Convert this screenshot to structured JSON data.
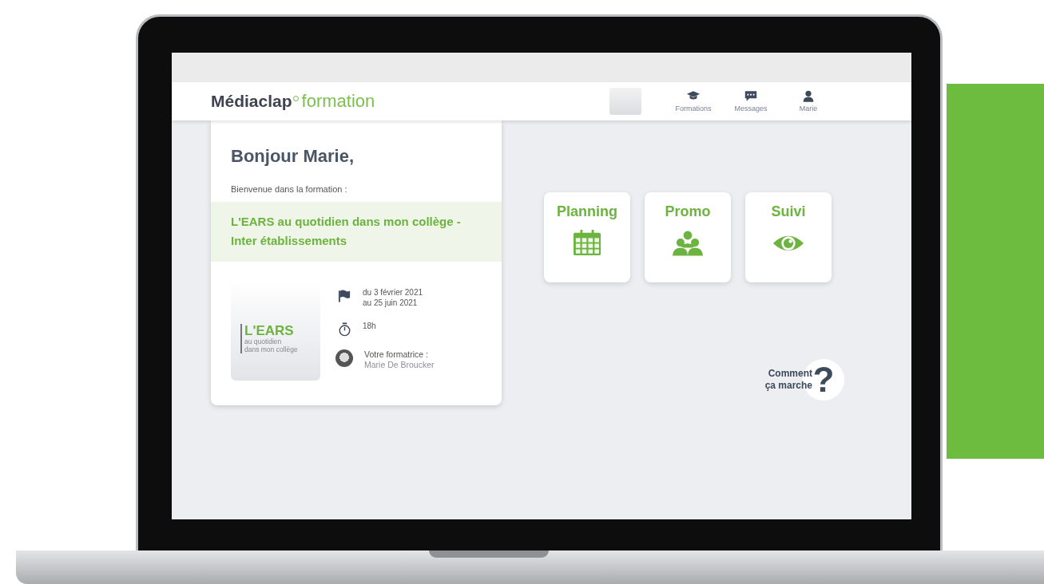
{
  "navbar": {
    "logo": {
      "brand": "Médiaclap",
      "product": "formation"
    },
    "items": [
      {
        "kind": "cap",
        "label": "Formations"
      },
      {
        "kind": "chat",
        "label": "Messages"
      },
      {
        "kind": "user",
        "label": "Marie"
      }
    ]
  },
  "welcome_card": {
    "greeting": "Bonjour Marie,",
    "intro": "Bienvenue dans la formation :",
    "course_title": "L'EARS au quotidien dans mon collège - Inter établissements",
    "cover": {
      "title": "L'EARS",
      "subtitle_lines": [
        "au quotidien",
        "dans mon collège"
      ]
    },
    "details": [
      {
        "kind": "dates",
        "lines": [
          "du 3 février 2021",
          "au 25 juin 2021"
        ]
      },
      {
        "kind": "duration",
        "lines": [
          "18h"
        ]
      },
      {
        "kind": "trainer",
        "lines": [
          "Votre formatrice :",
          "Marie De Broucker"
        ]
      }
    ]
  },
  "tiles": [
    {
      "kind": "calendar",
      "label": "Planning"
    },
    {
      "kind": "group",
      "label": "Promo"
    },
    {
      "kind": "eye",
      "label": "Suivi"
    }
  ],
  "help": {
    "lines": [
      "Comment",
      "ça marche"
    ],
    "symbol": "?"
  }
}
